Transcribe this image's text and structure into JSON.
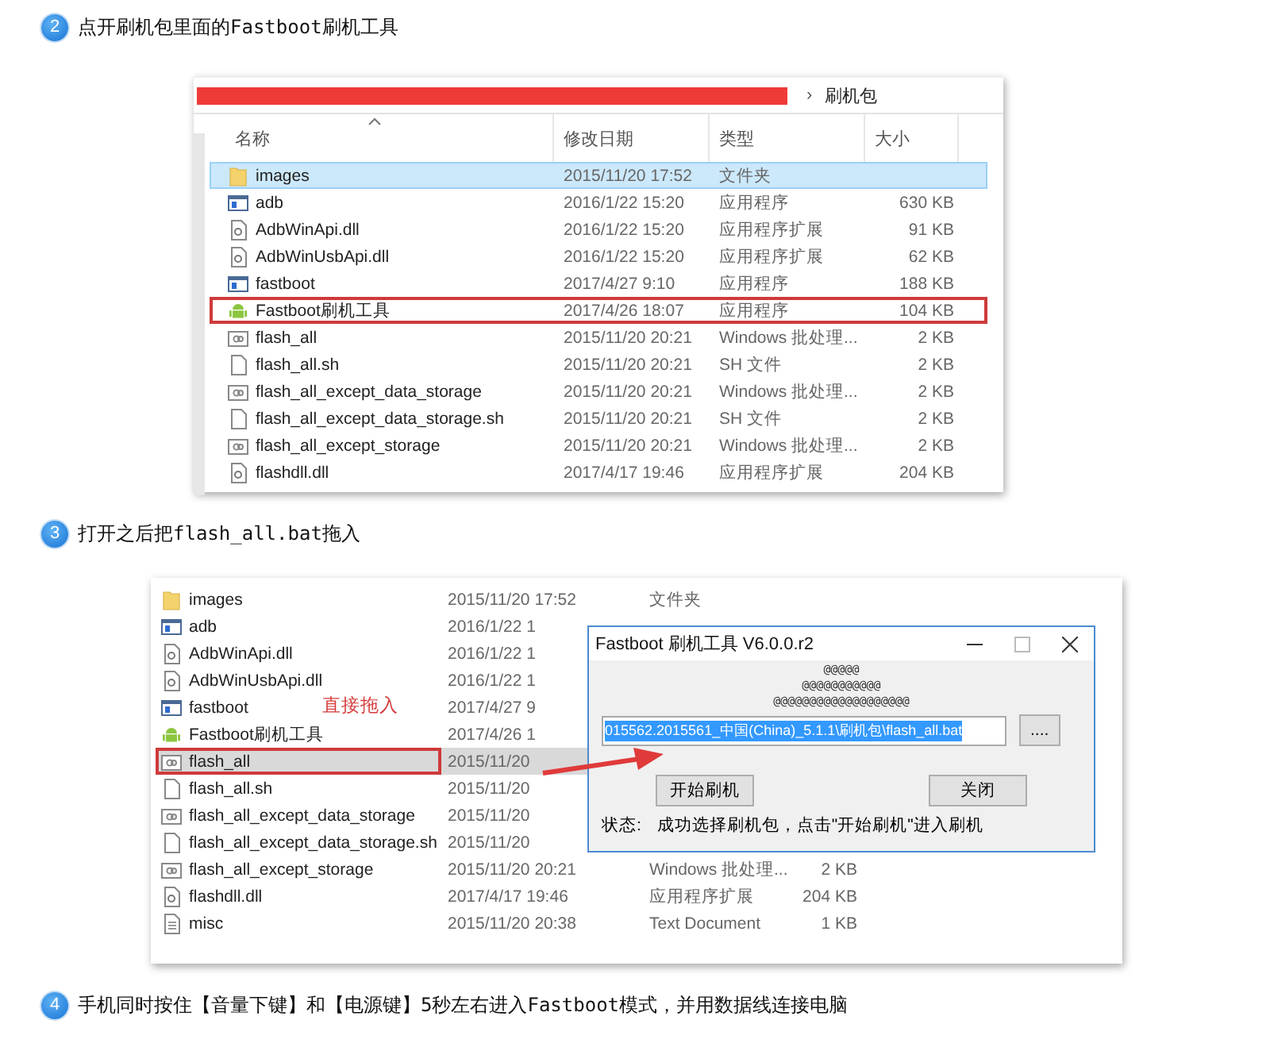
{
  "step_2": {
    "number": "2",
    "text": "点开刷机包里面的Fastboot刷机工具"
  },
  "explorer_1": {
    "address": {
      "separator": "›",
      "folder": "刷机包"
    },
    "columns": [
      {
        "label": "名称",
        "sorted": true
      },
      {
        "label": "修改日期",
        "sorted": false
      },
      {
        "label": "类型",
        "sorted": false
      },
      {
        "label": "大小",
        "sorted": false
      }
    ],
    "rows": [
      {
        "kind": "folder",
        "name": "images",
        "date": "2015/11/20 17:52",
        "type": "文件夹",
        "selected": true,
        "highlighted": false
      },
      {
        "kind": "app",
        "name": "adb",
        "date": "2016/1/22 15:20",
        "type": "应用程序",
        "size": "630 KB",
        "selected": false,
        "highlighted": false
      },
      {
        "kind": "dll",
        "name": "AdbWinApi.dll",
        "date": "2016/1/22 15:20",
        "type": "应用程序扩展",
        "size": "91 KB",
        "selected": false,
        "highlighted": false
      },
      {
        "kind": "dll",
        "name": "AdbWinUsbApi.dll",
        "date": "2016/1/22 15:20",
        "type": "应用程序扩展",
        "size": "62 KB",
        "selected": false,
        "highlighted": false
      },
      {
        "kind": "app",
        "name": "fastboot",
        "date": "2017/4/27 9:10",
        "type": "应用程序",
        "size": "188 KB",
        "selected": false,
        "highlighted": false
      },
      {
        "kind": "android",
        "name": "Fastboot刷机工具",
        "date": "2017/4/26 18:07",
        "type": "应用程序",
        "size": "104 KB",
        "selected": false,
        "highlighted": true
      },
      {
        "kind": "bat",
        "name": "flash_all",
        "date": "2015/11/20 20:21",
        "type": "Windows 批处理...",
        "size": "2 KB",
        "selected": false,
        "highlighted": false
      },
      {
        "kind": "file",
        "name": "flash_all.sh",
        "date": "2015/11/20 20:21",
        "type": "SH 文件",
        "size": "2 KB",
        "selected": false,
        "highlighted": false
      },
      {
        "kind": "bat",
        "name": "flash_all_except_data_storage",
        "date": "2015/11/20 20:21",
        "type": "Windows 批处理...",
        "size": "2 KB",
        "selected": false,
        "highlighted": false
      },
      {
        "kind": "file",
        "name": "flash_all_except_data_storage.sh",
        "date": "2015/11/20 20:21",
        "type": "SH 文件",
        "size": "2 KB",
        "selected": false,
        "highlighted": false
      },
      {
        "kind": "bat",
        "name": "flash_all_except_storage",
        "date": "2015/11/20 20:21",
        "type": "Windows 批处理...",
        "size": "2 KB",
        "selected": false,
        "highlighted": false
      },
      {
        "kind": "dll",
        "name": "flashdll.dll",
        "date": "2017/4/17 19:46",
        "type": "应用程序扩展",
        "size": "204 KB",
        "selected": false,
        "highlighted": false
      }
    ]
  },
  "step_3": {
    "number": "3",
    "text": "打开之后把flash_all.bat拖入"
  },
  "explorer_2": {
    "rows": [
      {
        "kind": "folder",
        "name": "images",
        "date": "2015/11/20 17:52",
        "type": "文件夹",
        "selected": false,
        "highlighted": false
      },
      {
        "kind": "app",
        "name": "adb",
        "date": "2016/1/22 1",
        "selected": false,
        "highlighted": false
      },
      {
        "kind": "dll",
        "name": "AdbWinApi.dll",
        "date": "2016/1/22 1",
        "selected": false,
        "highlighted": false
      },
      {
        "kind": "dll",
        "name": "AdbWinUsbApi.dll",
        "date": "2016/1/22 1",
        "selected": false,
        "highlighted": false
      },
      {
        "kind": "app",
        "name": "fastboot",
        "date": "2017/4/27 9",
        "selected": false,
        "highlighted": false
      },
      {
        "kind": "android",
        "name": "Fastboot刷机工具",
        "date": "2017/4/26 1",
        "selected": false,
        "highlighted": false
      },
      {
        "kind": "bat",
        "name": "flash_all",
        "date": "2015/11/20",
        "selected": true,
        "highlighted": true
      },
      {
        "kind": "file",
        "name": "flash_all.sh",
        "date": "2015/11/20",
        "selected": false,
        "highlighted": false
      },
      {
        "kind": "bat",
        "name": "flash_all_except_data_storage",
        "date": "2015/11/20",
        "selected": false,
        "highlighted": false
      },
      {
        "kind": "file",
        "name": "flash_all_except_data_storage.sh",
        "date": "2015/11/20",
        "selected": false,
        "highlighted": false
      },
      {
        "kind": "bat",
        "name": "flash_all_except_storage",
        "date": "2015/11/20 20:21",
        "type": "Windows 批处理...",
        "size": "2 KB",
        "selected": false,
        "highlighted": false
      },
      {
        "kind": "dll",
        "name": "flashdll.dll",
        "date": "2017/4/17 19:46",
        "type": "应用程序扩展",
        "size": "204 KB",
        "selected": false,
        "highlighted": false
      },
      {
        "kind": "text",
        "name": "misc",
        "date": "2015/11/20 20:38",
        "type": "Text Document",
        "size": "1 KB",
        "selected": false,
        "highlighted": false
      }
    ],
    "annotation": "直接拖入",
    "dialog": {
      "title": "Fastboot 刷机工具 V6.0.0.r2",
      "ascii_lines": [
        "@@@@@",
        "@@@@@@@@@@@",
        "@@@@@@@@@@@@@@@@@@@"
      ],
      "path": "015562.2015561_中国(China)_5.1.1\\刷机包\\flash_all.bat",
      "path_selected": true,
      "browse_button": "....",
      "buttons": [
        "开始刷机",
        "关闭"
      ],
      "status_label": "状态:",
      "status": "成功选择刷机包，点击\"开始刷机\"进入刷机"
    }
  },
  "step_4": {
    "number": "4",
    "text": "手机同时按住【音量下键】和【电源键】5秒左右进入Fastboot模式，并用数据线连接电脑"
  }
}
